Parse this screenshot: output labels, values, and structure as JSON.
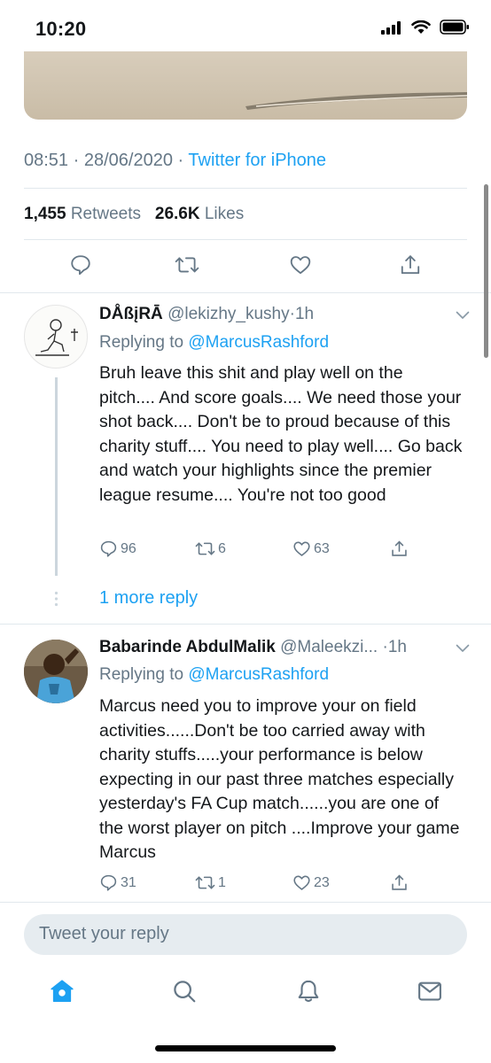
{
  "status_bar": {
    "time": "10:20"
  },
  "tweet": {
    "time": "08:51",
    "date": "28/06/2020",
    "separator": "·",
    "source": "Twitter for iPhone",
    "retweets_count": "1,455",
    "retweets_label": "Retweets",
    "likes_count": "26.6K",
    "likes_label": "Likes"
  },
  "replies": [
    {
      "name": "DÅßįRĀ",
      "handle": "@lekizhy_kushy",
      "age": "1h",
      "replying_prefix": "Replying to",
      "replying_to": "@MarcusRashford",
      "text": "Bruh leave this shit and play well on the pitch.... And score goals.... We need those your shot back.... Don't be to proud because of this charity stuff.... You need to play well.... Go back and watch your highlights since the premier league resume.... You're not too good",
      "reply_count": "96",
      "retweet_count": "6",
      "like_count": "63"
    },
    {
      "name": "Babarinde AbdulMalik",
      "handle": "@Maleekzi...",
      "age": "1h",
      "replying_prefix": "Replying to",
      "replying_to": "@MarcusRashford",
      "text": "Marcus need you to improve your on field activities......Don't be too carried away with charity stuffs.....your performance is below expecting in our past three matches especially yesterday's FA Cup match......you are one of the worst player on pitch ....Improve your game Marcus",
      "reply_count": "31",
      "retweet_count": "1",
      "like_count": "23"
    }
  ],
  "thread": {
    "more_replies": "1 more reply"
  },
  "composer": {
    "placeholder": "Tweet your reply"
  },
  "colors": {
    "accent": "#1da1f2",
    "secondary_text": "#657786",
    "divider": "#e1e8ed"
  },
  "icons": [
    "signal-icon",
    "wifi-icon",
    "battery-icon",
    "reply-icon",
    "retweet-icon",
    "like-icon",
    "share-icon",
    "chevron-down-icon",
    "home-icon",
    "search-icon",
    "notifications-icon",
    "messages-icon"
  ]
}
